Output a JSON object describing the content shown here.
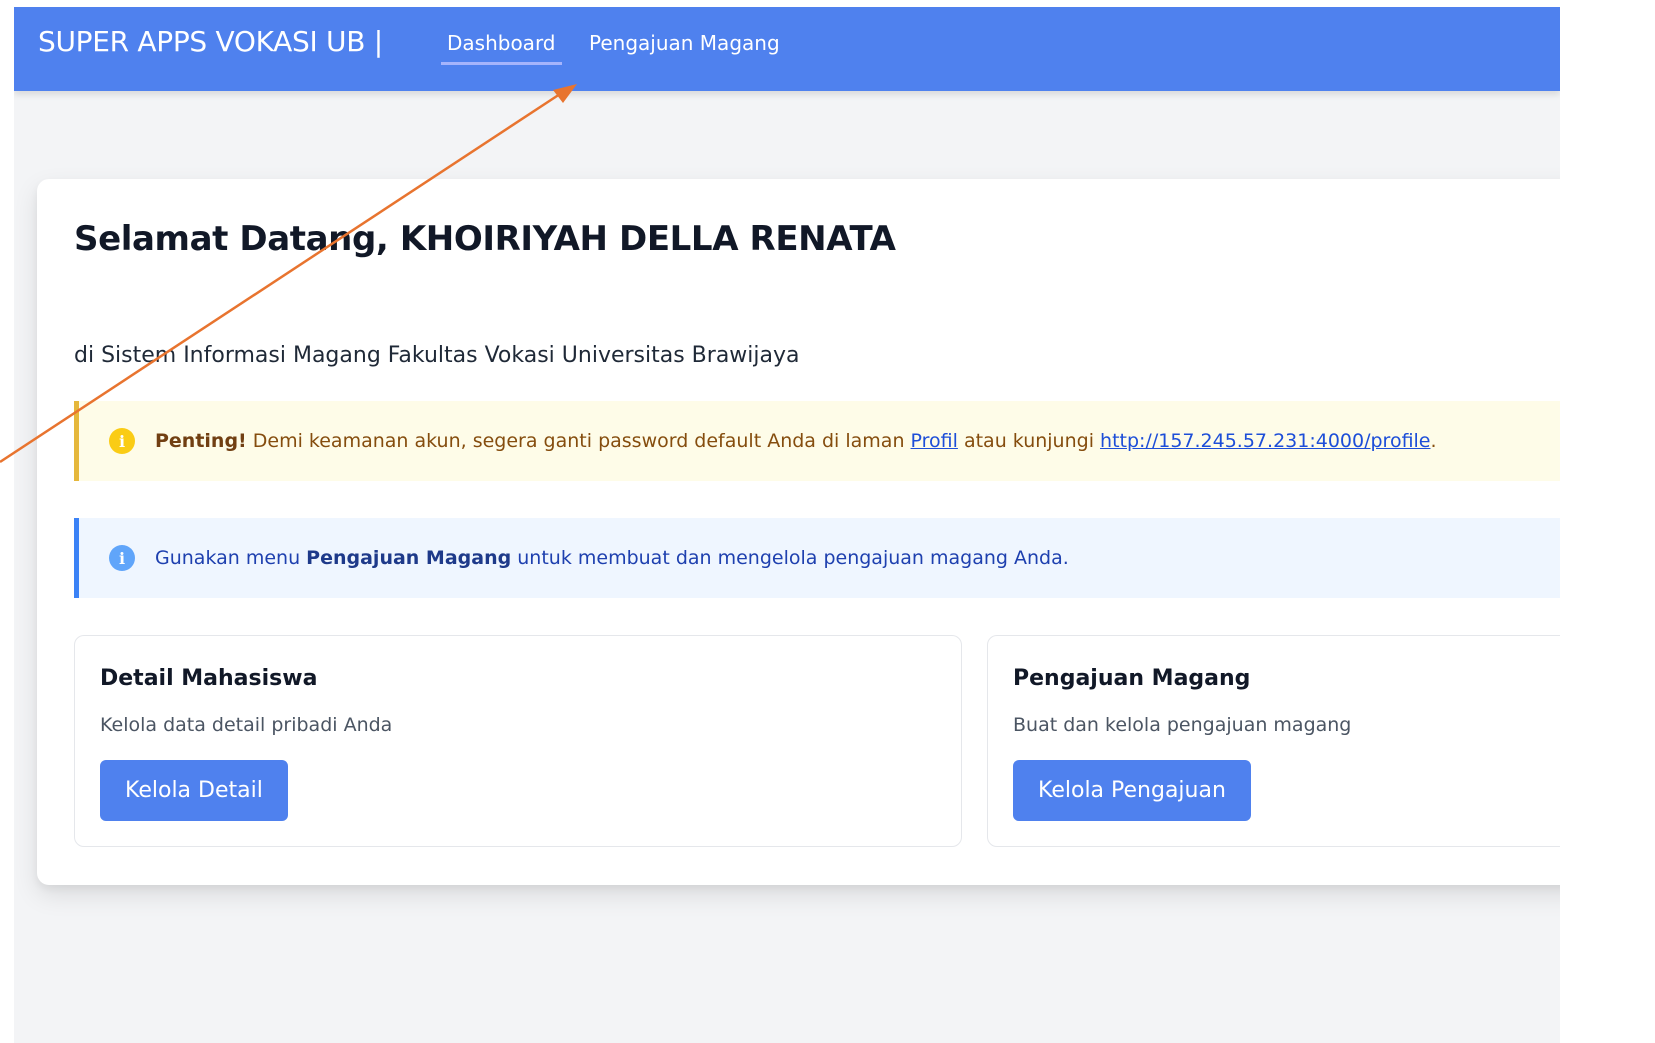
{
  "navbar": {
    "brand": "SUPER APPS VOKASI UB |",
    "links": [
      {
        "label": "Dashboard",
        "active": true
      },
      {
        "label": "Pengajuan Magang",
        "active": false
      }
    ],
    "color": "#4f81ee"
  },
  "welcome": {
    "title": "Selamat Datang, KHOIRIYAH DELLA RENATA",
    "subtitle": "di Sistem Informasi Magang Fakultas Vokasi Universitas Brawijaya"
  },
  "warning_alert": {
    "icon": "info-circle-icon",
    "strong": "Penting!",
    "text_before": " Demi keamanan akun, segera ganti password default Anda di laman ",
    "link_profile": "Profil",
    "text_middle": " atau kunjungi ",
    "link_url": "http://157.245.57.231:4000/profile",
    "text_after": "."
  },
  "info_alert": {
    "icon": "info-circle-icon",
    "text_before": "Gunakan menu ",
    "strong": "Pengajuan Magang",
    "text_after": " untuk membuat dan mengelola pengajuan magang Anda."
  },
  "cards": [
    {
      "title": "Detail Mahasiswa",
      "description": "Kelola data detail pribadi Anda",
      "button": "Kelola Detail"
    },
    {
      "title": "Pengajuan Magang",
      "description": "Buat dan kelola pengajuan magang",
      "button": "Kelola Pengajuan"
    }
  ],
  "annotation_arrow": {
    "icon": "annotation-arrow",
    "color": "#e8742f"
  }
}
